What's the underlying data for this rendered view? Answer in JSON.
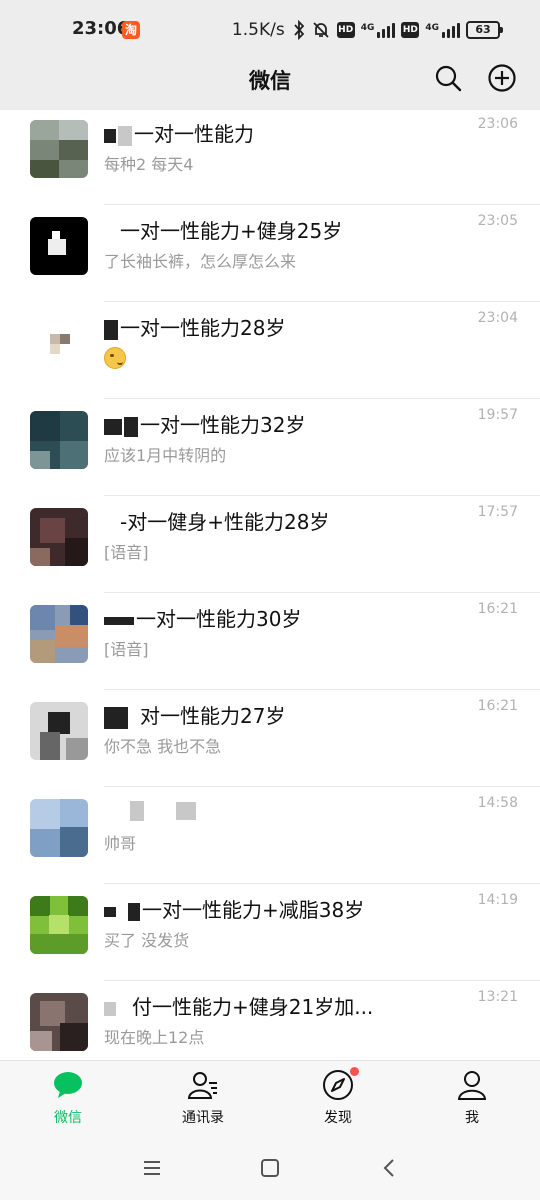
{
  "status_bar": {
    "time": "23:06",
    "app_badge": "淘",
    "speed": "1.5K/s",
    "network_1": "4G",
    "network_2": "4G",
    "hd_label": "HD",
    "battery": "63"
  },
  "header": {
    "title": "微信",
    "search_icon": "search-icon",
    "add_icon": "plus-circle-icon"
  },
  "chats": [
    {
      "name": "一对一性能力",
      "preview": "每种2   每天4",
      "time": "23:06"
    },
    {
      "name": "一对一性能力+健身25岁",
      "preview": "了长袖长裤，怎么厚怎么来",
      "time": "23:05"
    },
    {
      "name": "一对一性能力28岁",
      "preview": "",
      "time": "23:04",
      "preview_icon": "emoji-sticker"
    },
    {
      "name": "一对一性能力32岁",
      "preview": "应该1月中转阴的",
      "time": "19:57"
    },
    {
      "name": "-对一健身+性能力28岁",
      "preview": "[语音]",
      "time": "17:57"
    },
    {
      "name": "一对一性能力30岁",
      "preview": "[语音]",
      "time": "16:21"
    },
    {
      "name": "对一性能力27岁",
      "preview": "你不急 我也不急",
      "time": "16:21"
    },
    {
      "name": "",
      "preview": "帅哥",
      "time": "14:58"
    },
    {
      "name": "一对一性能力+减脂38岁",
      "preview": "买了 没发货",
      "time": "14:19"
    },
    {
      "name": "付一性能力+健身21岁加...",
      "preview": "现在晚上12点",
      "time": "13:21"
    }
  ],
  "tabs": [
    {
      "label": "微信",
      "icon": "chat-bubble-icon",
      "active": true
    },
    {
      "label": "通讯录",
      "icon": "contacts-icon",
      "active": false
    },
    {
      "label": "发现",
      "icon": "compass-icon",
      "active": false,
      "has_badge": true
    },
    {
      "label": "我",
      "icon": "person-icon",
      "active": false
    }
  ],
  "colors": {
    "accent": "#07c160",
    "badge_red": "#fa5151",
    "background": "#ededed"
  }
}
